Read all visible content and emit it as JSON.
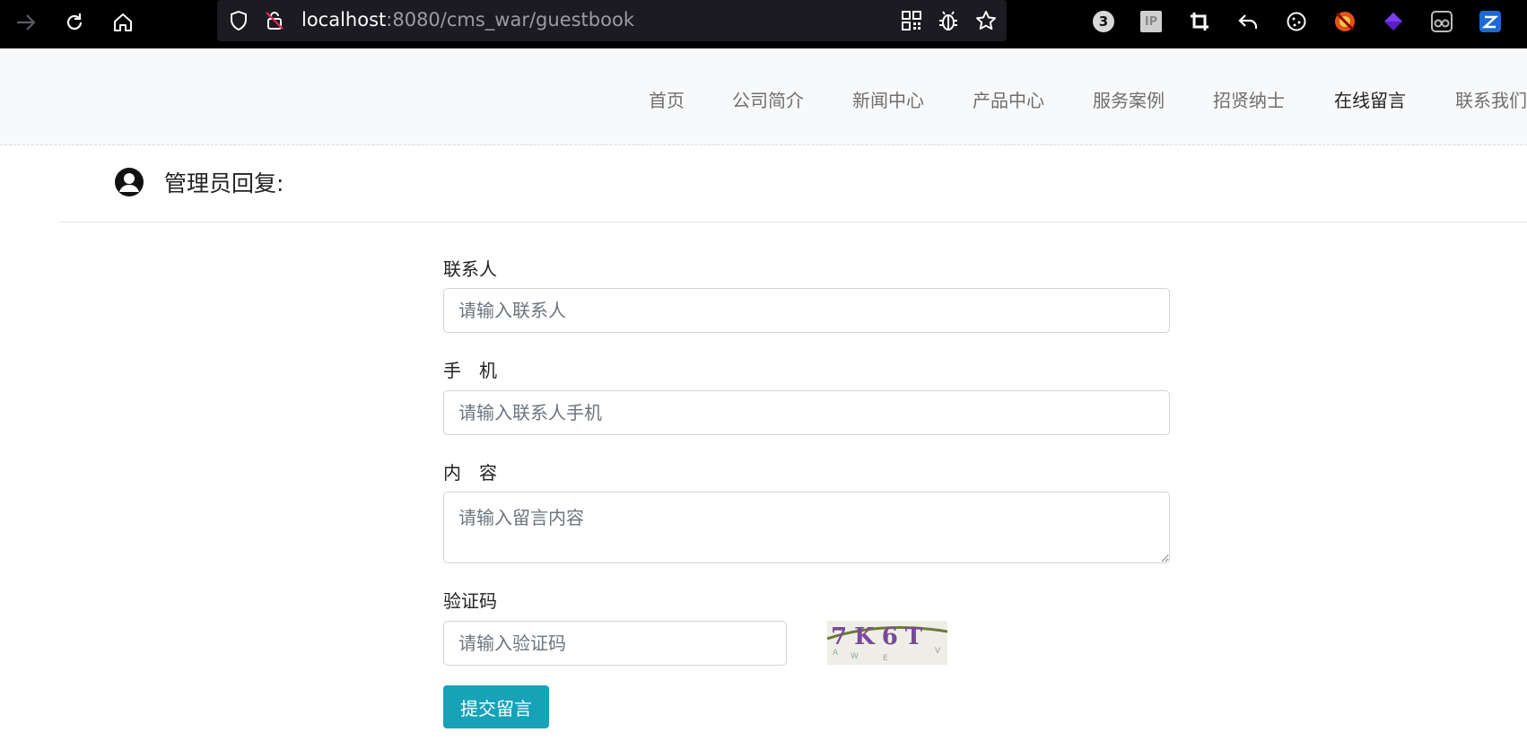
{
  "browser": {
    "url_host": "localhost",
    "url_path": ":8080/cms_war/guestbook",
    "badge_count": "3",
    "ip_label": "IP"
  },
  "nav": {
    "items": [
      {
        "label": "首页"
      },
      {
        "label": "公司简介"
      },
      {
        "label": "新闻中心"
      },
      {
        "label": "产品中心"
      },
      {
        "label": "服务案例"
      },
      {
        "label": "招贤纳士"
      },
      {
        "label": "在线留言"
      },
      {
        "label": "联系我们"
      }
    ],
    "active_color": "#222222"
  },
  "reply": {
    "title": "管理员回复:"
  },
  "form": {
    "contact": {
      "label": "联系人",
      "placeholder": "请输入联系人"
    },
    "phone": {
      "label": "手　机",
      "placeholder": "请输入联系人手机"
    },
    "content": {
      "label": "内　容",
      "placeholder": "请输入留言内容"
    },
    "captcha": {
      "label": "验证码",
      "placeholder": "请输入验证码",
      "image_text": "7K6T"
    },
    "submit_label": "提交留言",
    "submit_color": "#17a2b8"
  }
}
